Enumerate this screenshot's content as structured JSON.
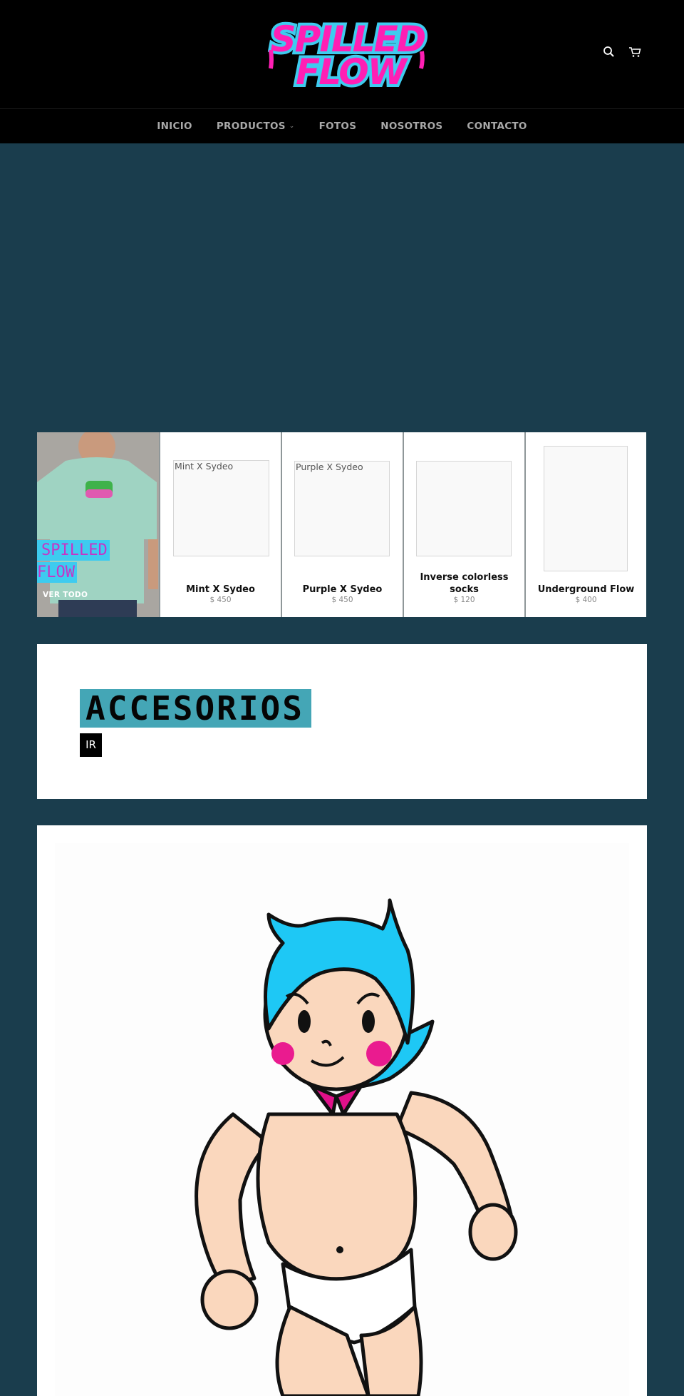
{
  "header": {
    "logo_alt": "SPILLED FLOW",
    "logo_line1": "SPILLED",
    "logo_line2": "FLOW",
    "icons": [
      "search-icon",
      "cart-icon"
    ]
  },
  "nav": {
    "items": [
      {
        "label": "INICIO"
      },
      {
        "label": "PRODUCTOS",
        "has_dropdown": true,
        "dropdown_glyph": "⌄"
      },
      {
        "label": "FOTOS"
      },
      {
        "label": "NOSOTROS"
      },
      {
        "label": "CONTACTO"
      }
    ]
  },
  "collection": {
    "featured": {
      "title_line1": "SPILLED",
      "title_line2": "FLOW",
      "link_label": "VER TODO"
    },
    "products": [
      {
        "name": "Mint X Sydeo",
        "price": "$ 450",
        "image_alt": "Mint X Sydeo"
      },
      {
        "name": "Purple X Sydeo",
        "price": "$ 450",
        "image_alt": "Purple X Sydeo"
      },
      {
        "name": "Inverse colorless socks",
        "price": "$ 120",
        "image_alt": ""
      },
      {
        "name": "Underground Flow",
        "price": "$ 400",
        "image_alt": ""
      }
    ]
  },
  "accessories": {
    "title": "ACCESORIOS",
    "button_label": "IR"
  },
  "colors": {
    "page_bg": "#1a3d4d",
    "header_bg": "#000000",
    "nav_text": "#a9a9a9",
    "logo_pink": "#ff1fb4",
    "logo_cyan": "#3ecbef",
    "accent_teal": "#44a6b6",
    "featured_title_text": "#c634c6"
  }
}
